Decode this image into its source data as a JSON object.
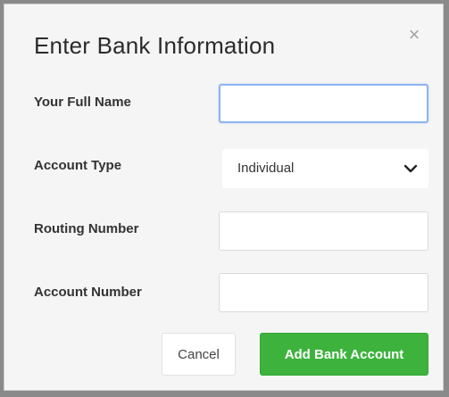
{
  "dialog": {
    "title": "Enter Bank Information",
    "close_symbol": "×"
  },
  "form": {
    "full_name": {
      "label": "Your Full Name",
      "value": ""
    },
    "account_type": {
      "label": "Account Type",
      "selected": "Individual"
    },
    "routing_number": {
      "label": "Routing Number",
      "value": ""
    },
    "account_number": {
      "label": "Account Number",
      "value": ""
    }
  },
  "actions": {
    "cancel_label": "Cancel",
    "submit_label": "Add Bank Account"
  },
  "colors": {
    "primary_button": "#3db33d",
    "focus_border": "#8fb4f0"
  },
  "icons": {
    "close": "close-icon",
    "select": "chevron-down-icon"
  }
}
